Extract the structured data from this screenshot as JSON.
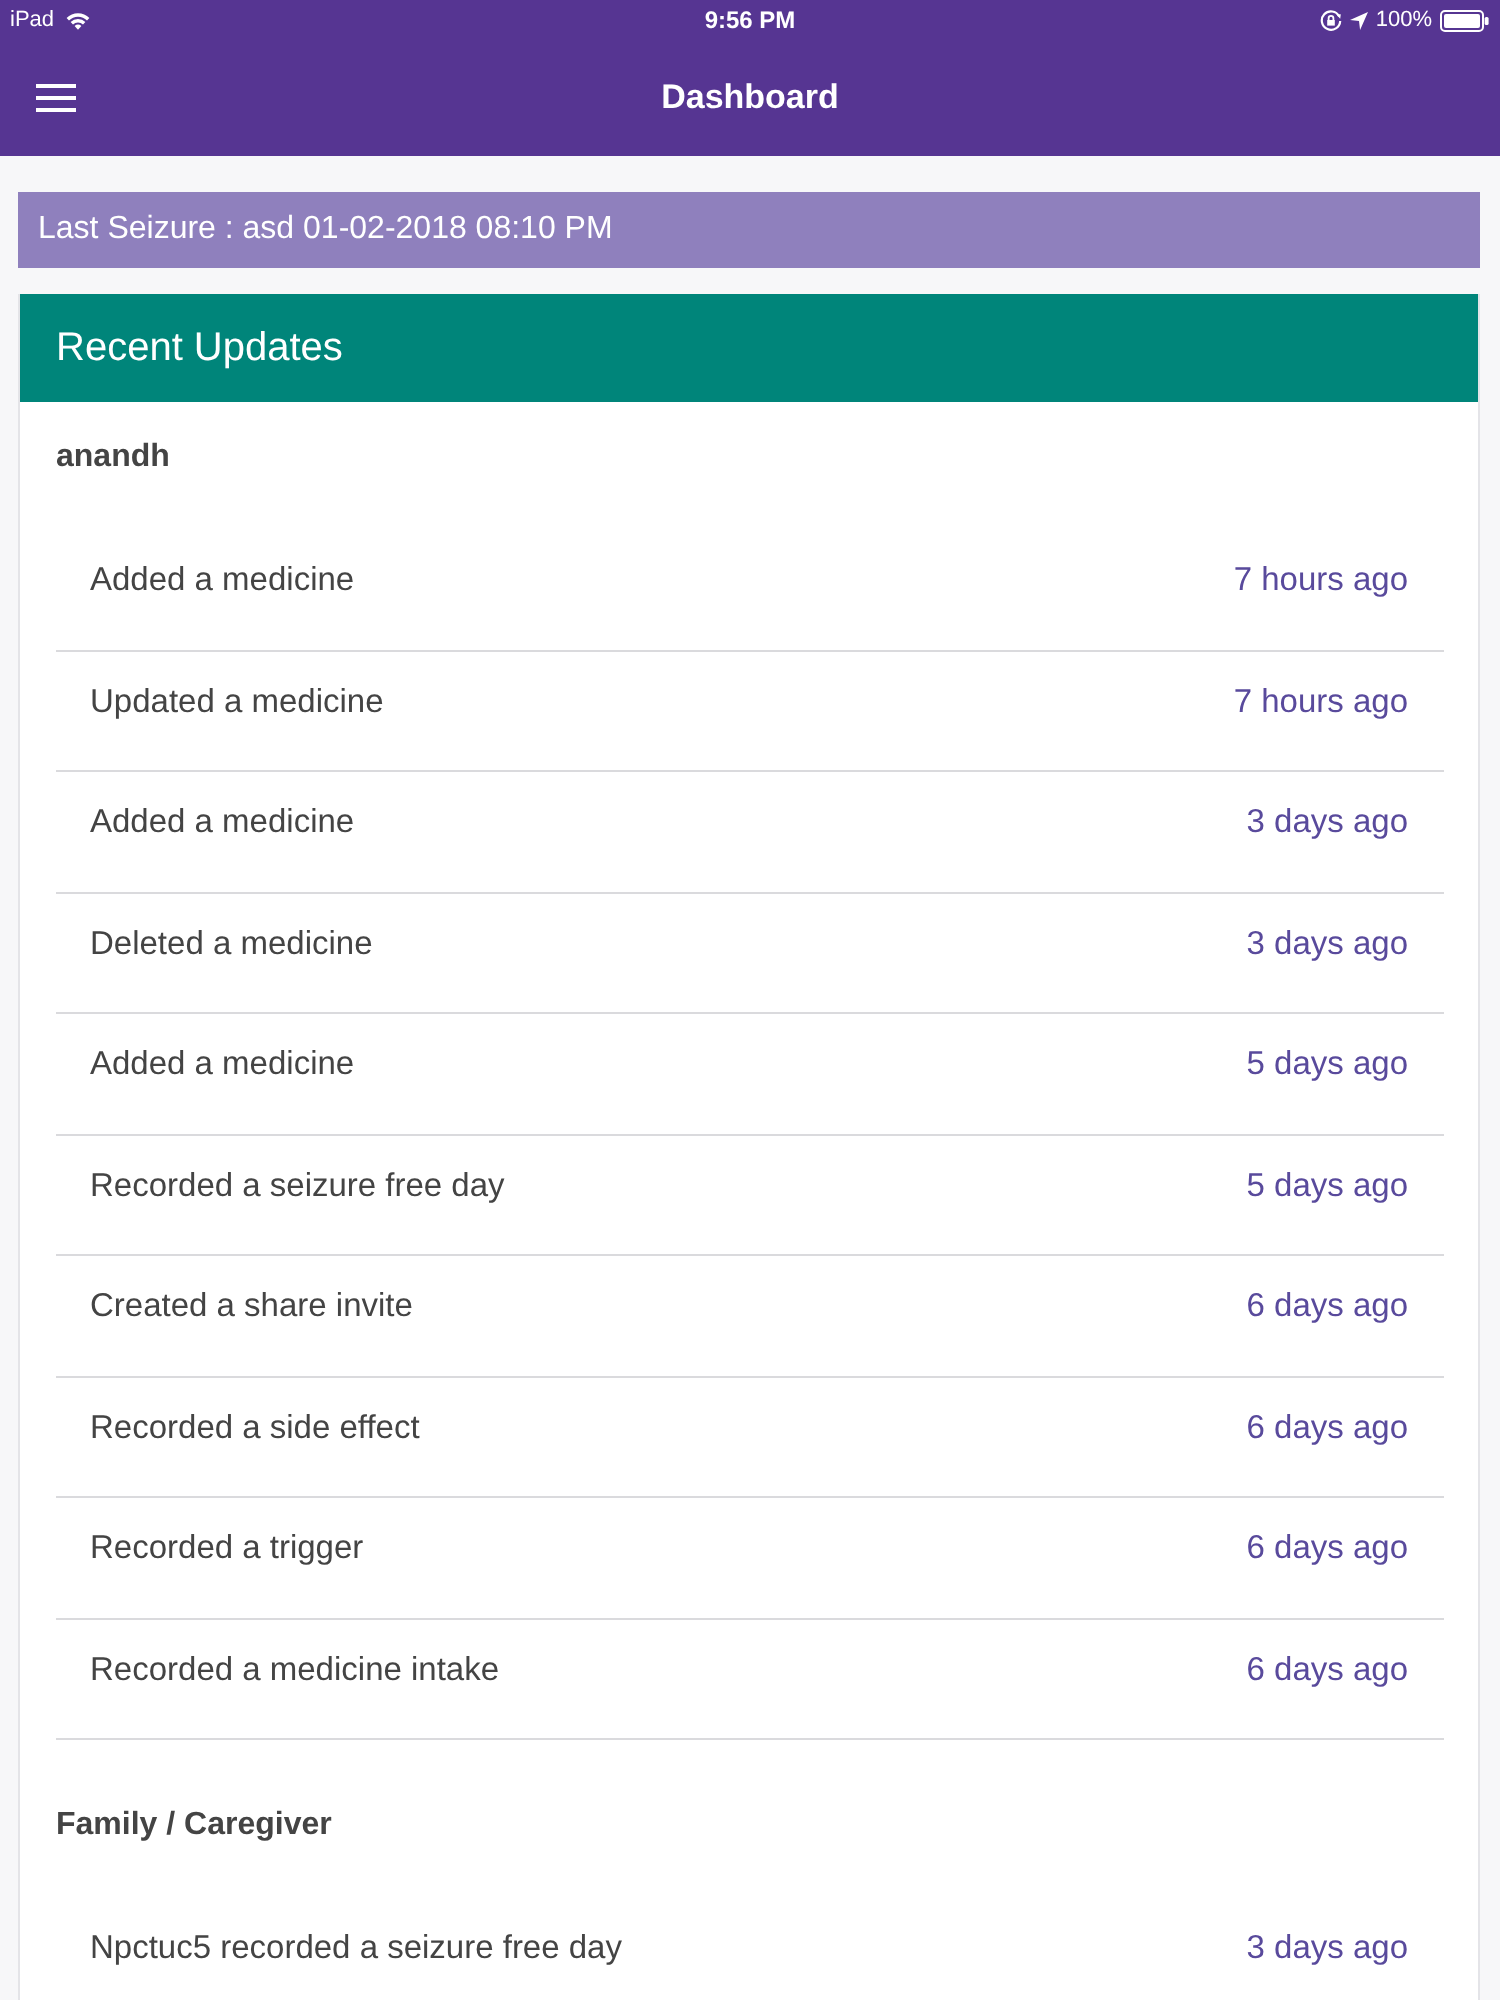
{
  "status_bar": {
    "device": "iPad",
    "time": "9:56 PM",
    "battery": "100%"
  },
  "nav_bar": {
    "title": "Dashboard"
  },
  "last_seizure": {
    "text": "Last Seizure : asd 01-02-2018 08:10 PM"
  },
  "recent_updates": {
    "title": "Recent Updates",
    "sections": [
      {
        "name": "anandh",
        "items": [
          {
            "action": "Added a medicine",
            "time": "7 hours ago"
          },
          {
            "action": "Updated a medicine",
            "time": "7 hours ago"
          },
          {
            "action": "Added a medicine",
            "time": "3 days ago"
          },
          {
            "action": "Deleted a medicine",
            "time": "3 days ago"
          },
          {
            "action": "Added a medicine",
            "time": "5 days ago"
          },
          {
            "action": "Recorded a seizure free day",
            "time": "5 days ago"
          },
          {
            "action": "Created a share invite",
            "time": "6 days ago"
          },
          {
            "action": "Recorded a side effect",
            "time": "6 days ago"
          },
          {
            "action": "Recorded a trigger",
            "time": "6 days ago"
          },
          {
            "action": "Recorded a medicine intake",
            "time": "6 days ago"
          }
        ]
      },
      {
        "name": "Family / Caregiver",
        "items": [
          {
            "action": "Npctuc5 recorded a seizure free day",
            "time": "3 days ago"
          }
        ]
      }
    ]
  }
}
